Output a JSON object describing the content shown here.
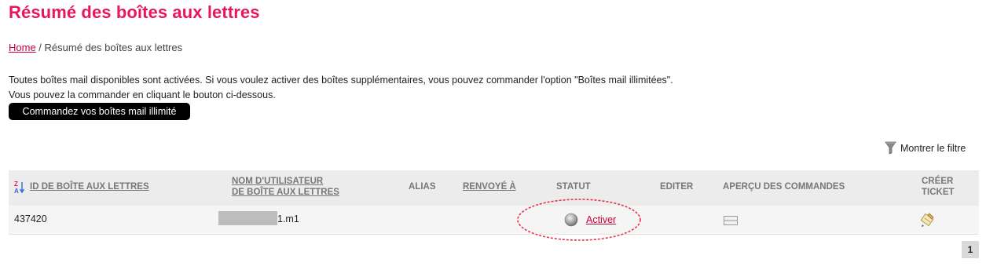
{
  "page": {
    "title": "Résumé des boîtes aux lettres"
  },
  "breadcrumb": {
    "home": "Home",
    "separator": " / ",
    "current": "Résumé des boîtes aux lettres"
  },
  "intro": {
    "line1": "Toutes boîtes mail disponibles sont activées. Si vous voulez activer des boîtes supplémentaires, vous pouvez commander l'option \"Boîtes mail illimitées\".",
    "line2": "Vous pouvez la commander en cliquant le bouton ci-dessous."
  },
  "order_button": {
    "label": "Commandez vos boîtes mail illimité"
  },
  "filter": {
    "label": "Montrer le filtre",
    "icon": "funnel-icon"
  },
  "table": {
    "columns": {
      "mailbox_id": "ID DE BOÎTE AUX LETTRES",
      "username_line1": "NOM D'UTILISATEUR",
      "username_line2": "DE BOÎTE AUX LETTRES",
      "alias": "ALIAS",
      "forwarded": "RENVOYÉ À",
      "status": "STATUT",
      "edit": "EDITER",
      "orders": "APERÇU DES COMMANDES",
      "ticket_line1": "CRÉER",
      "ticket_line2": "TICKET"
    },
    "sort_icon": "sort-az-icon",
    "rows": [
      {
        "id": "437420",
        "username_suffix": "1.m1",
        "alias": "",
        "forwarded": "",
        "status_action": "Activer",
        "status_icon": "grey-status-dot-icon",
        "orders_icon": "order-preview-icon",
        "ticket_icon": "ticket-pencil-icon"
      }
    ]
  },
  "pagination": {
    "current_page": "1"
  },
  "colors": {
    "title": "#e8175d",
    "link": "#c8003c",
    "header_bg": "#ececec",
    "row_bg": "#f5f5f5",
    "annotation": "#e8324f"
  }
}
